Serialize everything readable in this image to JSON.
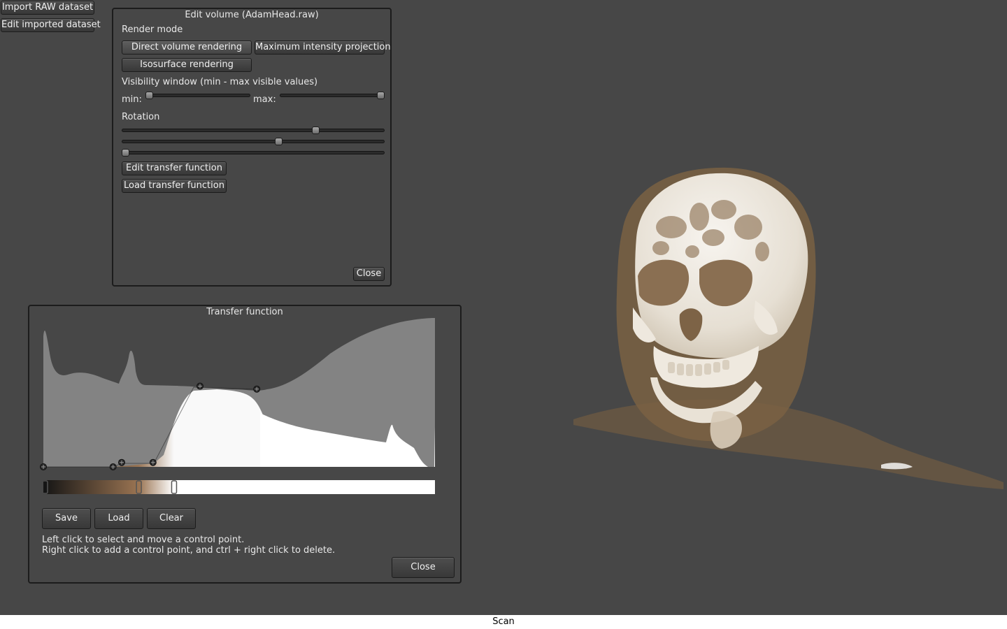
{
  "top_buttons": {
    "import_raw": "Import RAW dataset",
    "edit_imported": "Edit imported dataset"
  },
  "edit_volume": {
    "title": "Edit volume (AdamHead.raw)",
    "render_mode_label": "Render mode",
    "modes": {
      "direct": "Direct volume rendering",
      "mip": "Maximum intensity projection",
      "iso": "Isosurface rendering"
    },
    "selected_mode": "direct",
    "visibility_label": "Visibility window (min - max visible values)",
    "min_label": "min:",
    "max_label": "max:",
    "visibility_min": 0.0,
    "visibility_max": 1.0,
    "rotation_label": "Rotation",
    "rotation_values": [
      0.745,
      0.6,
      0.0
    ],
    "edit_tf_button": "Edit transfer function",
    "load_tf_button": "Load transfer function",
    "close_button": "Close"
  },
  "transfer_function": {
    "title": "Transfer function",
    "alpha_points": [
      {
        "x": 0.0,
        "a": 0.0
      },
      {
        "x": 0.178,
        "a": 0.0
      },
      {
        "x": 0.2,
        "a": 0.03
      },
      {
        "x": 0.28,
        "a": 0.03
      },
      {
        "x": 0.4,
        "a": 0.55
      },
      {
        "x": 0.545,
        "a": 0.53
      }
    ],
    "color_points": [
      {
        "x": 0.0,
        "color": "#151515"
      },
      {
        "x": 0.243,
        "color": "#9a7452"
      },
      {
        "x": 0.333,
        "color": "#ffffff"
      }
    ],
    "save_button": "Save",
    "load_button": "Load",
    "clear_button": "Clear",
    "help_line1": "Left click to select and move a control point.",
    "help_line2": "Right click to add a control point, and ctrl + right click to delete.",
    "close_button": "Close"
  },
  "status_bar": {
    "text": "Scan"
  },
  "colors": {
    "background": "#474747",
    "bone": "#f2eee8",
    "tissue": "#8a6a45"
  }
}
